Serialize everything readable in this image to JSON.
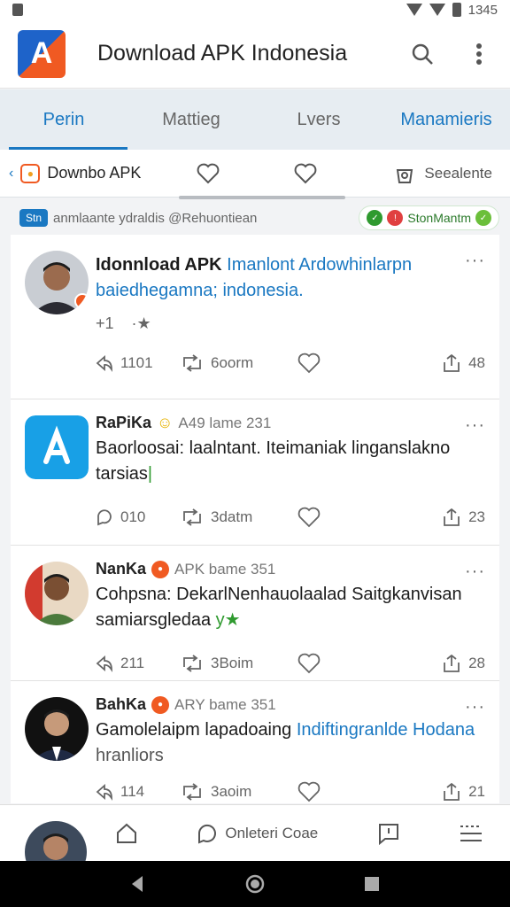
{
  "status": {
    "time": "1345"
  },
  "app": {
    "title": "Download APK Indonesia",
    "logo_letter": "A"
  },
  "tabs": [
    {
      "label": "Perin"
    },
    {
      "label": "Mattieg"
    },
    {
      "label": "Lvers"
    },
    {
      "label": "Manamieris"
    }
  ],
  "subbar": {
    "left_label": "Downbo APK",
    "right_label": "Seealente"
  },
  "banner": {
    "badge": "Stn",
    "text": "anmlaante ydraldis @Rehuontiean",
    "right_label": "StonMantm"
  },
  "posts": [
    {
      "head_bold": "Idonnload APK",
      "head_link": "Imanlont Ardowhinlarpn",
      "text_link": "baiedhegamna; indonesia.",
      "extra1": "+1",
      "extra2": "·★",
      "reply_count": "1101",
      "repost_count": "6oorm",
      "share_count": "48"
    },
    {
      "name": "RaPiKa",
      "meta": "A49 lame 231",
      "text": "Baorloosai: laalntant. Iteimaniak linganslakno",
      "text2": "tarsias",
      "reply_count": "010",
      "repost_count": "3datm",
      "share_count": "23"
    },
    {
      "name": "NanKa",
      "meta": "APK bame 351",
      "text": "Cohpsna: DekarlNenhauolaalad Saitgkanvisan",
      "text2": "samiarsgledaa",
      "text2_suffix": "y★",
      "reply_count": "211",
      "repost_count": "3Boim",
      "share_count": "28"
    },
    {
      "name": "BahKa",
      "meta": "ARY bame 351",
      "text": "Gamolelaipm lapadoaing",
      "text_link": "Indiftingranlde Hodana",
      "text2": "hranliors",
      "reply_count": "114",
      "repost_count": "3aoim",
      "share_count": "21"
    }
  ],
  "bottom_nav": {
    "compose_label": "Onleteri Coae"
  },
  "colors": {
    "accent": "#1a78c2",
    "brand_orange": "#f05a22",
    "tab_bg": "#e7edf2"
  }
}
